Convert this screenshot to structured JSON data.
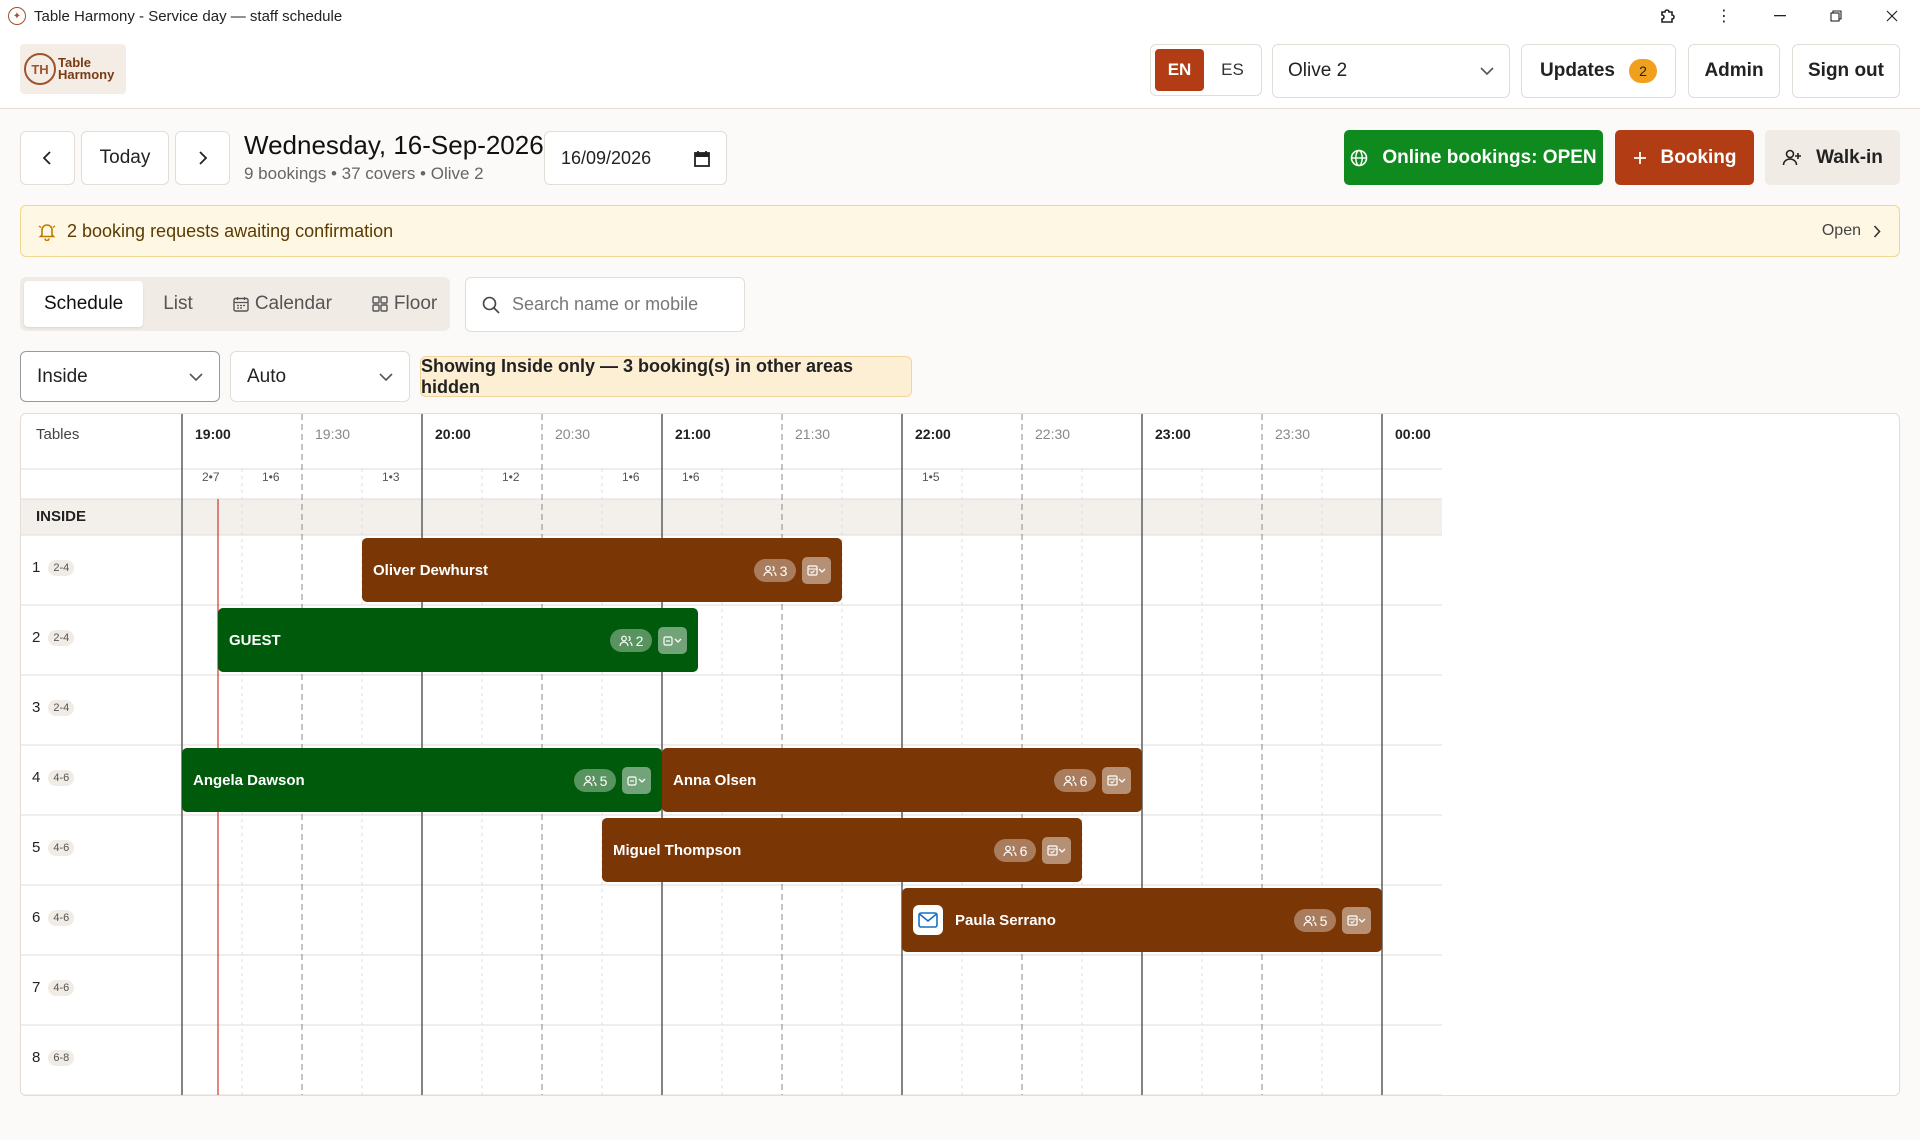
{
  "window": {
    "title": "Table Harmony - Service day — staff schedule"
  },
  "header": {
    "logo_text_1": "Table",
    "logo_text_2": "Harmony",
    "lang": [
      "EN",
      "ES"
    ],
    "venue": "Olive 2",
    "updates_label": "Updates",
    "updates_count": "2",
    "admin_label": "Admin",
    "signout_label": "Sign out"
  },
  "toolbar": {
    "today_label": "Today",
    "date_title": "Wednesday, 16-Sep-2026",
    "date_sub": "9 bookings • 37 covers • Olive 2",
    "date_value": "16/09/2026",
    "online_label": "Online bookings: OPEN",
    "booking_label": "Booking",
    "walkin_label": "Walk-in"
  },
  "alert": {
    "text": "2 booking requests awaiting confirmation",
    "open_label": "Open"
  },
  "tabs": [
    "Schedule",
    "List",
    "Calendar",
    "Floor"
  ],
  "search": {
    "placeholder": "Search name or mobile"
  },
  "filters": {
    "area": "Inside",
    "mode": "Auto",
    "notice": "Showing Inside only — 3 booking(s) in other areas hidden"
  },
  "schedule": {
    "tables_header": "Tables",
    "section": "INSIDE",
    "hours": [
      "19:00",
      "20:00",
      "21:00",
      "22:00",
      "23:00",
      "00:00"
    ],
    "halves": [
      "19:30",
      "20:30",
      "21:30",
      "22:30",
      "23:30"
    ],
    "covers": [
      {
        "slot": 0,
        "text": "2•7"
      },
      {
        "slot": 1,
        "text": "1•6"
      },
      {
        "slot": 3,
        "text": "1•3"
      },
      {
        "slot": 5,
        "text": "1•2"
      },
      {
        "slot": 7,
        "text": "1•6"
      },
      {
        "slot": 8,
        "text": "1•6"
      },
      {
        "slot": 12,
        "text": "1•5"
      }
    ],
    "tables": [
      {
        "num": "1",
        "cap": "2-4"
      },
      {
        "num": "2",
        "cap": "2-4"
      },
      {
        "num": "3",
        "cap": "2-4"
      },
      {
        "num": "4",
        "cap": "4-6"
      },
      {
        "num": "5",
        "cap": "4-6"
      },
      {
        "num": "6",
        "cap": "4-6"
      },
      {
        "num": "7",
        "cap": "4-6"
      },
      {
        "num": "8",
        "cap": "6-8"
      }
    ],
    "bookings": [
      {
        "name": "Oliver Dewhurst",
        "table": 0,
        "start": "19:45",
        "end": "21:45",
        "pax": "3",
        "status": "confirmed",
        "color": "#7a3605"
      },
      {
        "name": "GUEST",
        "table": 1,
        "start": "19:09",
        "end": "21:09",
        "pax": "2",
        "status": "walk-in",
        "color": "#005a0c"
      },
      {
        "name": "Angela Dawson",
        "table": 3,
        "start": "19:00",
        "end": "21:00",
        "pax": "5",
        "status": "walk-in",
        "color": "#005a0c"
      },
      {
        "name": "Anna Olsen",
        "table": 3,
        "start": "21:00",
        "end": "23:00",
        "pax": "6",
        "status": "confirmed",
        "color": "#7a3605"
      },
      {
        "name": "Miguel Thompson",
        "table": 4,
        "start": "20:45",
        "end": "22:45",
        "pax": "6",
        "status": "confirmed",
        "color": "#7a3605"
      },
      {
        "name": "Paula Serrano",
        "table": 5,
        "start": "22:00",
        "end": "00:00",
        "pax": "5",
        "status": "confirmed",
        "mail": true,
        "color": "#7a3605"
      }
    ],
    "now_time": "19:09"
  },
  "colors": {
    "accent": "#b23d14",
    "open_green": "#0e8a1e",
    "walkin_green": "#005a0c",
    "booking_brown": "#7a3605"
  }
}
